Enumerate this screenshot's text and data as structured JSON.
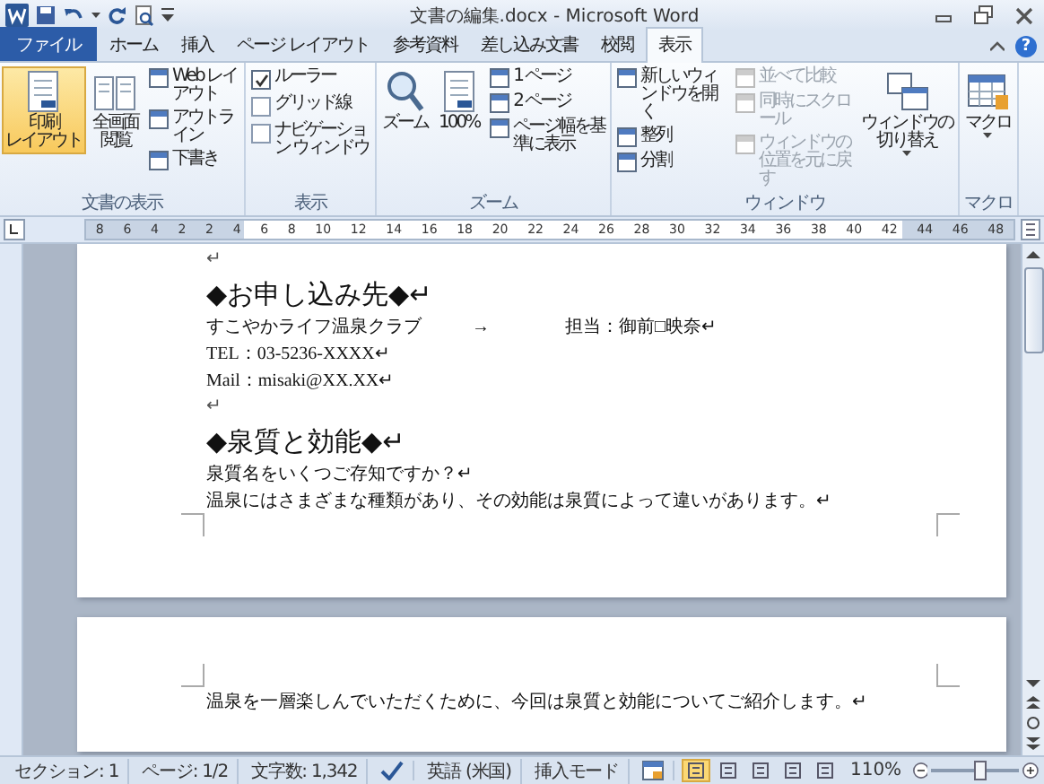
{
  "window": {
    "title": "文書の編集.docx - Microsoft Word"
  },
  "tabs": [
    {
      "label": "ファイル",
      "kind": "file",
      "selected": false
    },
    {
      "label": "ホーム",
      "kind": "tab",
      "selected": false
    },
    {
      "label": "挿入",
      "kind": "tab",
      "selected": false
    },
    {
      "label": "ページ レイアウト",
      "kind": "tab",
      "selected": false
    },
    {
      "label": "参考資料",
      "kind": "tab",
      "selected": false
    },
    {
      "label": "差し込み文書",
      "kind": "tab",
      "selected": false
    },
    {
      "label": "校閲",
      "kind": "tab",
      "selected": false
    },
    {
      "label": "表示",
      "kind": "tab",
      "selected": true
    }
  ],
  "help": {
    "label": "?"
  },
  "ribbon": {
    "groups": [
      {
        "label": "文書の表示",
        "columns": [
          [
            {
              "kind": "large",
              "lines": [
                "印刷",
                "レイアウト"
              ],
              "selected": true,
              "dropdown": false
            }
          ],
          [
            {
              "kind": "large",
              "lines": [
                "全画面",
                "閲覧"
              ],
              "selected": false,
              "dropdown": false
            }
          ],
          [
            {
              "kind": "small",
              "label": "Web レイアウト",
              "selected": false
            },
            {
              "kind": "small",
              "label": "アウトライン",
              "selected": false
            },
            {
              "kind": "small",
              "label": "下書き",
              "selected": false
            }
          ]
        ]
      },
      {
        "label": "表示",
        "columns": [
          [
            {
              "kind": "check",
              "label": "ルーラー",
              "checked": true
            },
            {
              "kind": "check",
              "label": "グリッド線",
              "checked": false
            },
            {
              "kind": "check",
              "label": "ナビゲーション ウィンドウ",
              "checked": false
            }
          ]
        ]
      },
      {
        "label": "ズーム",
        "columns": [
          [
            {
              "kind": "large",
              "lines": [
                "ズーム"
              ],
              "dropdown": false
            }
          ],
          [
            {
              "kind": "large",
              "lines": [
                "100%"
              ],
              "dropdown": false
            }
          ],
          [
            {
              "kind": "small",
              "label": "1 ページ"
            },
            {
              "kind": "small",
              "label": "2 ページ"
            },
            {
              "kind": "small",
              "label": "ページ幅を基準に表示"
            }
          ]
        ]
      },
      {
        "label": "ウィンドウ",
        "columns": [
          [
            {
              "kind": "small",
              "label": "新しいウィンドウを開く",
              "disabled": false
            },
            {
              "kind": "small",
              "label": "整列",
              "disabled": false
            },
            {
              "kind": "small",
              "label": "分割",
              "disabled": false
            }
          ],
          [
            {
              "kind": "small",
              "label": "並べて比較",
              "disabled": true
            },
            {
              "kind": "small",
              "label": "同時にスクロール",
              "disabled": true
            },
            {
              "kind": "small",
              "label": "ウィンドウの位置を元に戻す",
              "disabled": true
            }
          ],
          [
            {
              "kind": "large",
              "lines": [
                "ウィンドウの",
                "切り替え"
              ],
              "dropdown": true
            }
          ]
        ]
      },
      {
        "label": "マクロ",
        "columns": [
          [
            {
              "kind": "large",
              "lines": [
                "マクロ"
              ],
              "dropdown": true
            }
          ]
        ]
      }
    ]
  },
  "ruler": {
    "labels": [
      "8",
      "6",
      "4",
      "2",
      "2",
      "4",
      "6",
      "8",
      "10",
      "12",
      "14",
      "16",
      "18",
      "20",
      "22",
      "24",
      "26",
      "28",
      "30",
      "32",
      "34",
      "36",
      "38",
      "40",
      "42",
      "44",
      "46",
      "48"
    ]
  },
  "pages": [
    {
      "paragraphs": [
        {
          "kind": "mark",
          "text": "↵"
        },
        {
          "kind": "heading",
          "text": "◆お申し込み先◆↵"
        },
        {
          "kind": "tabbed",
          "text": "すこやかライフ温泉クラブ",
          "tab": "→",
          "after": "担当：御前□映奈↵"
        },
        {
          "kind": "body",
          "text": "TEL：03-5236-XXXX↵"
        },
        {
          "kind": "body",
          "text": "Mail：misaki@XX.XX↵"
        },
        {
          "kind": "mark",
          "text": "↵"
        },
        {
          "kind": "heading",
          "text": "◆泉質と効能◆↵"
        },
        {
          "kind": "body",
          "text": "泉質名をいくつご存知ですか？↵"
        },
        {
          "kind": "body",
          "text": "温泉にはさまざまな種類があり、その効能は泉質によって違いがあります。↵"
        }
      ]
    },
    {
      "paragraphs": [
        {
          "kind": "body",
          "text": "温泉を一層楽しんでいただくために、今回は泉質と効能についてご紹介します。↵"
        }
      ]
    }
  ],
  "status_bar": {
    "items": [
      {
        "kind": "text",
        "label": "セクション: 1"
      },
      {
        "kind": "text",
        "label": "ページ: 1/2"
      },
      {
        "kind": "text",
        "label": "文字数: 1,342"
      },
      {
        "kind": "spellcheck"
      },
      {
        "kind": "text",
        "label": "英語 (米国)"
      },
      {
        "kind": "text",
        "label": "挿入モード"
      },
      {
        "kind": "macro"
      }
    ],
    "view_buttons": [
      {
        "selected": true
      },
      {
        "selected": false
      },
      {
        "selected": false
      },
      {
        "selected": false
      },
      {
        "selected": false
      }
    ],
    "zoom": "110%",
    "level": 0.57
  }
}
